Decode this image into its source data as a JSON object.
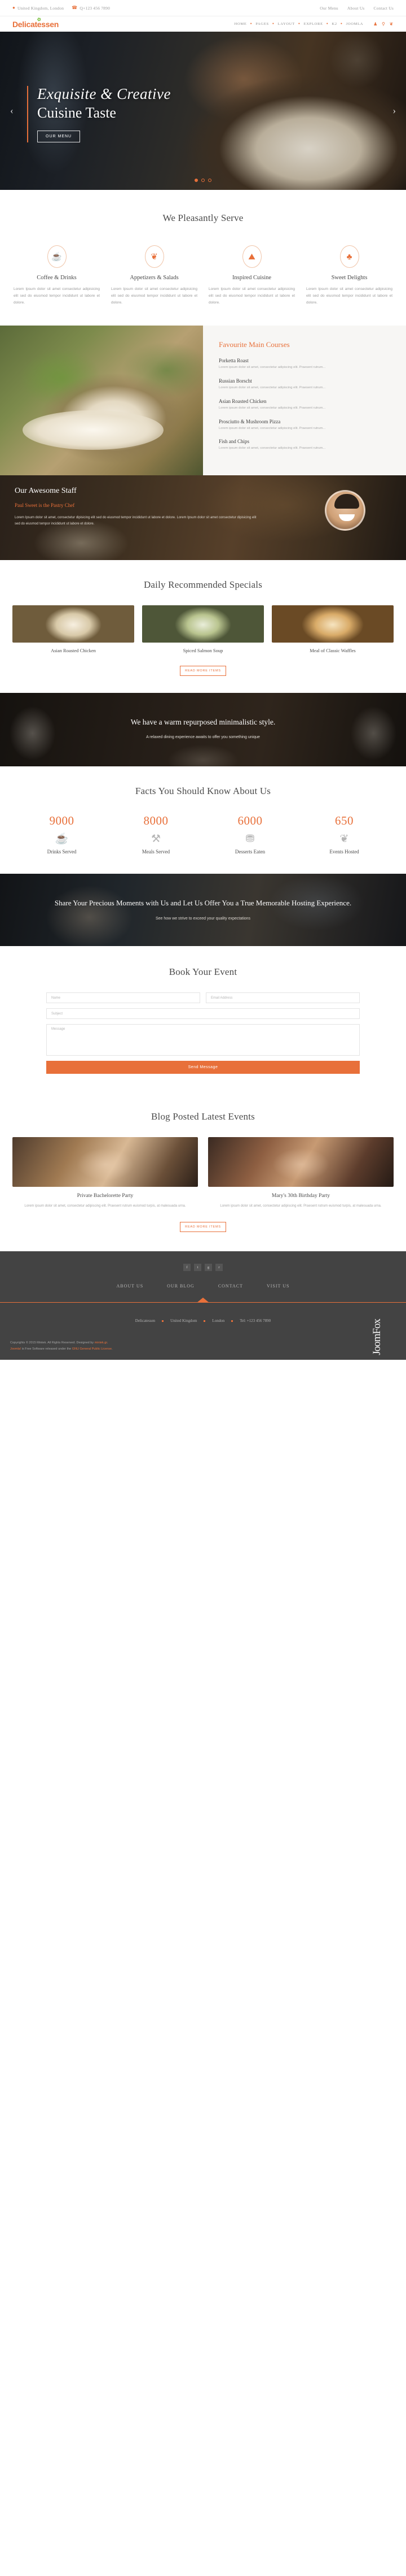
{
  "topbar": {
    "location_icon": "map-pin-icon",
    "location": "United Kingdom, London",
    "phone_icon": "phone-icon",
    "phone": "Q+123 456 7890",
    "links": [
      {
        "label": "Our Menu"
      },
      {
        "label": "About Us"
      },
      {
        "label": "Contact Us"
      }
    ]
  },
  "header": {
    "logo": "Delicatessen",
    "leaf_icon": "leaf-icon",
    "nav": [
      {
        "label": "HOME"
      },
      {
        "label": "PAGES"
      },
      {
        "label": "LAYOUT"
      },
      {
        "label": "EXPLORE"
      },
      {
        "label": "K2"
      },
      {
        "label": "JOOMLA"
      }
    ],
    "icons": [
      {
        "name": "user-icon",
        "glyph": "♟"
      },
      {
        "name": "search-icon",
        "glyph": "⚲"
      },
      {
        "name": "cart-icon",
        "glyph": "❦"
      }
    ]
  },
  "hero": {
    "title_italic": "Exquisite & Creative",
    "title_plain": "Cuisine Taste",
    "button": "Our Menu",
    "prev_icon": "chevron-left-icon",
    "next_icon": "chevron-right-icon",
    "slides": 3,
    "active_slide": 1
  },
  "services": {
    "title": "We Pleasantly Serve",
    "items": [
      {
        "icon": "coffee-cup-icon",
        "glyph": "☕",
        "title": "Coffee & Drinks",
        "text": "Lorem Ipsum dolor sit amet consectetur adipisicing elit sed do eiusmod tempor incididunt ut labore et dolore."
      },
      {
        "icon": "salad-bowl-icon",
        "glyph": "❦",
        "title": "Appetizers & Salads",
        "text": "Lorem Ipsum dolor sit amet consectetur adipisicing elit sed do eiusmod tempor incididunt ut labore et dolore."
      },
      {
        "icon": "cloche-icon",
        "glyph": "⛰",
        "title": "Inspired Cuisine",
        "text": "Lorem Ipsum dolor sit amet consectetur adipisicing elit sed do eiusmod tempor incididunt ut labore et dolore."
      },
      {
        "icon": "cupcake-icon",
        "glyph": "♣",
        "title": "Sweet Delights",
        "text": "Lorem Ipsum dolor sit amet consectetur adipisicing elit sed do eiusmod tempor incididunt ut labore et dolore."
      }
    ]
  },
  "menu": {
    "title": "Favourite Main Courses",
    "items": [
      {
        "name": "Porketta Roast",
        "desc": "Lorem ipsum dolor sit amet, consectetur adipiscing elit. Praesent rutrum..."
      },
      {
        "name": "Russian Borscht",
        "desc": "Lorem ipsum dolor sit amet, consectetur adipiscing elit. Praesent rutrum..."
      },
      {
        "name": "Asian Roasted Chicken",
        "desc": "Lorem ipsum dolor sit amet, consectetur adipiscing elit. Praesent rutrum..."
      },
      {
        "name": "Prosciutto & Mushroom Pizza",
        "desc": "Lorem ipsum dolor sit amet, consectetur adipiscing elit. Praesent rutrum..."
      },
      {
        "name": "Fish and Chips",
        "desc": "Lorem ipsum dolor sit amet, consectetur adipiscing elit. Praesent rutrum..."
      }
    ]
  },
  "staff": {
    "title": "Our Awesome Staff",
    "name_prefix": "Paul Sweet is ",
    "role": "the Pastry Chef",
    "text": "Lorem Ipsum dolor sit amet, consectetur dipisicing elit sed do eiusmod tempor incididunt ut labore et dolore. Lorem Ipsum dolor sit amet consectetur dipisicing elit sed do eiusmod tempor incididunt ut labore et dolore.",
    "avatar": "chef-avatar"
  },
  "specials": {
    "title": "Daily Recommended Specials",
    "items": [
      {
        "title": "Asian Roasted Chicken",
        "image": "asian-roasted-chicken-photo"
      },
      {
        "title": "Spiced Salmon Soup",
        "image": "spiced-salmon-soup-photo"
      },
      {
        "title": "Meal of Classic Waffles",
        "image": "classic-waffles-photo"
      }
    ],
    "button": "Read More Items"
  },
  "quote": {
    "heading": "We have a warm repurposed minimalistic style.",
    "text": "A relaxed dining experience awaits to offer you something unique"
  },
  "facts": {
    "title": "Facts You Should Know About Us",
    "items": [
      {
        "number": "9000",
        "label": "Drinks Served",
        "icon": "drink-glass-icon",
        "glyph": "☕"
      },
      {
        "number": "8000",
        "label": "Meals Served",
        "icon": "cutlery-icon",
        "glyph": "⚒"
      },
      {
        "number": "6000",
        "label": "Desserts Eaten",
        "icon": "cake-icon",
        "glyph": "⛃"
      },
      {
        "number": "650",
        "label": "Events Hosted",
        "icon": "balloons-icon",
        "glyph": "❦"
      }
    ]
  },
  "cta": {
    "heading": "Share Your Precious Moments with Us and Let Us Offer You a True Memorable Hosting Experience.",
    "text": "See how we strive to exceed your quality expectations"
  },
  "book": {
    "title": "Book Your Event",
    "fields": {
      "name_placeholder": "Name",
      "email_placeholder": "Email Address",
      "subject_placeholder": "Subject",
      "message_placeholder": "Message"
    },
    "submit": "Send Message"
  },
  "blog": {
    "title": "Blog Posted Latest Events",
    "posts": [
      {
        "title": "Private Bachelorette Party",
        "excerpt": "Lorem ipsum dolor sit amet, consectetur adipiscing elit. Praesent rutrum euismod turpis, at malesuada urna.",
        "image": "bachelorette-party-photo"
      },
      {
        "title": "Mary's 30th Birthday Party",
        "excerpt": "Lorem ipsum dolor sit amet, consectetur adipiscing elit. Praesent rutrum euismod turpis, at malesuada urna.",
        "image": "birthday-party-photo"
      }
    ],
    "button": "Read More Items"
  },
  "footer": {
    "socials": [
      {
        "name": "facebook-icon",
        "glyph": "f"
      },
      {
        "name": "twitter-icon",
        "glyph": "t"
      },
      {
        "name": "google-plus-icon",
        "glyph": "g"
      },
      {
        "name": "rss-icon",
        "glyph": "r"
      }
    ],
    "nav": [
      {
        "label": "ABOUT US"
      },
      {
        "label": "OUR BLOG"
      },
      {
        "label": "CONTACT"
      },
      {
        "label": "VISIT US"
      }
    ],
    "meta": [
      {
        "label": "Delicatessen"
      },
      {
        "label": "United Kingdom"
      },
      {
        "label": "London"
      },
      {
        "label": "Tel: +123 456 7890"
      }
    ],
    "copyright_line1_a": "Copyrights © 2015 Mintek. All Rights Reserved. Designed by ",
    "copyright_link1": "mintek.gr",
    "copyright_line1_b": ".",
    "copyright_link2": "Joomla!",
    "copyright_line2_a": " is Free Software released under the ",
    "copyright_link3": "GNU General Public License",
    "copyright_line2_b": ".",
    "brand_mark": "JoomFox"
  },
  "colors": {
    "accent": "#e8703a",
    "leaf": "#7cc142",
    "dark": "#434343"
  }
}
